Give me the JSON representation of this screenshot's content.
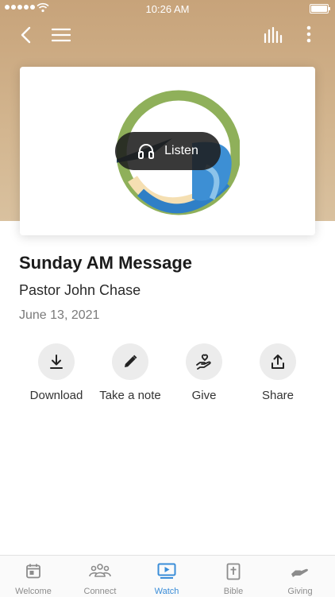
{
  "status_bar": {
    "time": "10:26 AM"
  },
  "media": {
    "listen_label": "Listen"
  },
  "message": {
    "title": "Sunday AM Message",
    "speaker": "Pastor John Chase",
    "date": "June 13, 2021"
  },
  "actions": [
    {
      "label": "Download",
      "icon": "download-icon"
    },
    {
      "label": "Take a note",
      "icon": "pencil-icon"
    },
    {
      "label": "Give",
      "icon": "give-heart-hand-icon"
    },
    {
      "label": "Share",
      "icon": "share-icon"
    }
  ],
  "tabs": [
    {
      "label": "Welcome",
      "icon": "calendar-icon"
    },
    {
      "label": "Connect",
      "icon": "people-icon"
    },
    {
      "label": "Watch",
      "icon": "play-screen-icon",
      "active": true
    },
    {
      "label": "Bible",
      "icon": "bible-icon"
    },
    {
      "label": "Giving",
      "icon": "hand-icon"
    }
  ],
  "colors": {
    "accent": "#3a8dd8",
    "hero_bg": "#d3b690",
    "logo_green": "#8fb05a",
    "logo_blue": "#2f7fc6",
    "logo_cream": "#f5dfb2"
  }
}
